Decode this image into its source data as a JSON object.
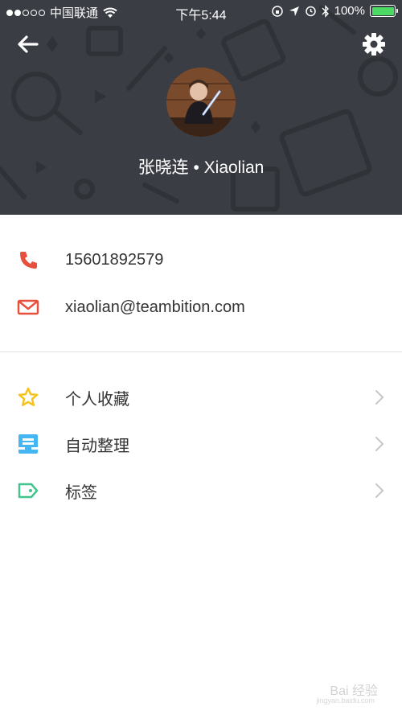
{
  "status_bar": {
    "carrier": "中国联通",
    "time": "下午5:44",
    "battery_percent": "100%",
    "signal_bars_filled": 2,
    "signal_bars_total": 5
  },
  "header": {
    "back_icon": "arrow-left-icon",
    "settings_icon": "gear-icon",
    "profile_name": "张晓连 • Xiaolian"
  },
  "contact": {
    "phone": "15601892579",
    "email": "xiaolian@teambition.com",
    "phone_icon_color": "#e8503e",
    "email_icon_color": "#e8503e"
  },
  "menu": {
    "items": [
      {
        "label": "个人收藏",
        "icon": "star-icon",
        "color": "#f5c31d"
      },
      {
        "label": "自动整理",
        "icon": "inbox-icon",
        "color": "#43b6f3"
      },
      {
        "label": "标签",
        "icon": "tag-icon",
        "color": "#43c38d"
      }
    ]
  },
  "watermark": {
    "text": "Bai 经验",
    "sub": "jingyan.baidu.com"
  }
}
